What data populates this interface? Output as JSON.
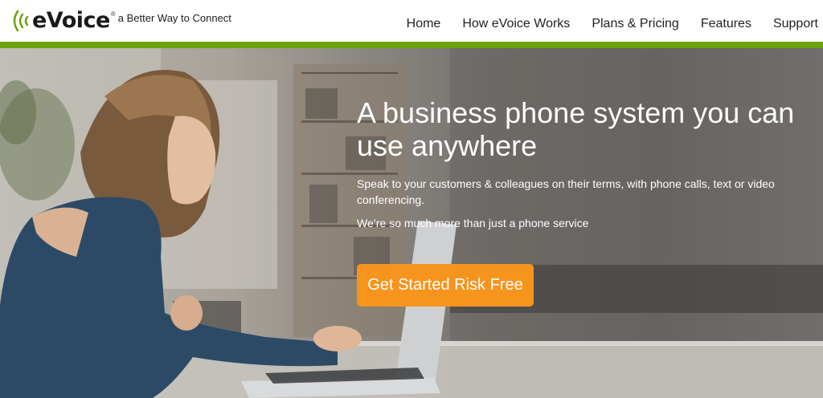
{
  "brand": {
    "name": "eVoice",
    "registered": "®",
    "tagline": "a Better Way to Connect",
    "accent_color": "#6aa40c"
  },
  "nav": {
    "items": [
      {
        "label": "Home"
      },
      {
        "label": "How eVoice Works"
      },
      {
        "label": "Plans & Pricing"
      },
      {
        "label": "Features"
      },
      {
        "label": "Support"
      }
    ]
  },
  "hero": {
    "title": "A business phone system you can use anywhere",
    "subtitle": "Speak to your customers & colleagues on their terms, with phone calls, text or video conferencing.",
    "subtitle2": "We’re so much more than just a phone service",
    "cta_label": "Get Started Risk Free",
    "cta_color": "#f7941d"
  }
}
